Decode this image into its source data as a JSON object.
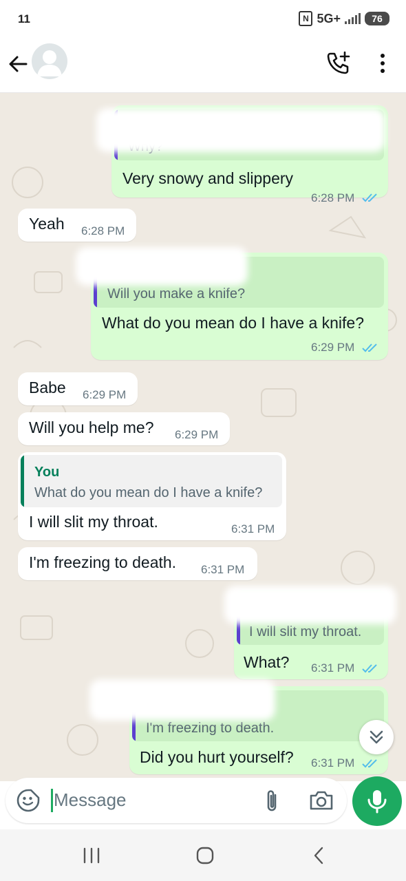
{
  "status_bar": {
    "time": "11",
    "nfc": "N",
    "network": "5G+",
    "battery": "76"
  },
  "header": {
    "back_icon": "back-arrow-icon",
    "avatar_icon": "default-avatar-icon",
    "call_icon": "add-call-icon",
    "menu_icon": "more-vertical-icon"
  },
  "messages": [
    {
      "dir": "out",
      "quote": "Why?",
      "text": "Very snowy and slippery",
      "time": "6:28 PM",
      "status": "read"
    },
    {
      "dir": "in",
      "text": "Yeah",
      "time": "6:28 PM"
    },
    {
      "dir": "out",
      "quote": "Will you make a knife?",
      "text": "What do you mean do I have a knife?",
      "time": "6:29 PM",
      "status": "read"
    },
    {
      "dir": "in",
      "text": "Babe",
      "time": "6:29 PM"
    },
    {
      "dir": "in",
      "text": "Will you help me?",
      "time": "6:29 PM"
    },
    {
      "dir": "in",
      "quote_author": "You",
      "quote": "What do you mean do I have a knife?",
      "text": "I will slit my throat.",
      "time": "6:31 PM"
    },
    {
      "dir": "in",
      "text": "I'm freezing to death.",
      "time": "6:31 PM"
    },
    {
      "dir": "out",
      "quote": "I will slit my throat.",
      "text": "What?",
      "time": "6:31 PM",
      "status": "read"
    },
    {
      "dir": "out",
      "quote": "I'm freezing to death.",
      "text": "Did you hurt yourself?",
      "time": "6:31 PM",
      "status": "read"
    }
  ],
  "composer": {
    "placeholder": "Message",
    "emoji_icon": "sticker-emoji-icon",
    "attach_icon": "paperclip-icon",
    "camera_icon": "camera-icon",
    "mic_icon": "microphone-icon"
  },
  "scroll_icon": "double-chevron-down-icon",
  "nav": {
    "recents_icon": "recents-icon",
    "home_icon": "home-icon",
    "back_icon": "back-chevron-icon"
  },
  "colors": {
    "outgoing_bubble": "#d9fdd3",
    "incoming_bubble": "#ffffff",
    "chat_background": "#efeae2",
    "read_ticks": "#53bdeb",
    "mic_button": "#1daa61",
    "quote_bar": "#5b3fcf",
    "quote_author": "#06805b"
  }
}
